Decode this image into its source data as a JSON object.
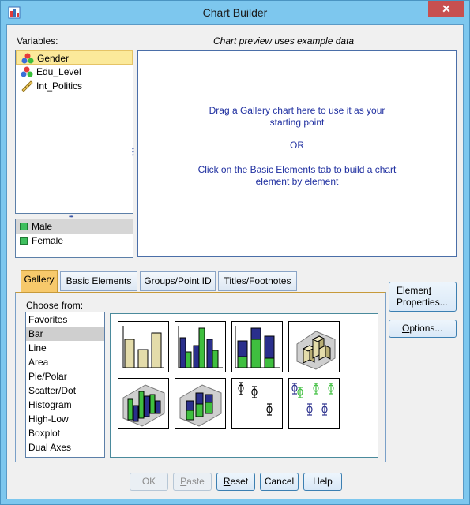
{
  "window": {
    "title": "Chart Builder",
    "close_glyph": "✕"
  },
  "variables": {
    "label": "Variables:",
    "items": [
      {
        "label": "Gender",
        "icon": "nominal-icon",
        "selected": true
      },
      {
        "label": "Edu_Level",
        "icon": "nominal-icon",
        "selected": false
      },
      {
        "label": "Int_Politics",
        "icon": "scale-icon",
        "selected": false
      }
    ]
  },
  "categories": {
    "items": [
      {
        "label": "Male",
        "selected": true
      },
      {
        "label": "Female",
        "selected": false
      }
    ]
  },
  "preview": {
    "caption": "Chart preview uses example data",
    "line1": "Drag a Gallery chart here to use it as your",
    "line2": "starting point",
    "line3": "OR",
    "line4": "Click on the Basic Elements tab to build a chart",
    "line5": "element by element"
  },
  "tabs": [
    {
      "label": "Gallery",
      "active": true
    },
    {
      "label": "Basic Elements",
      "active": false
    },
    {
      "label": "Groups/Point ID",
      "active": false
    },
    {
      "label": "Titles/Footnotes",
      "active": false
    }
  ],
  "choose": {
    "label": "Choose from:",
    "items": [
      "Favorites",
      "Bar",
      "Line",
      "Area",
      "Pie/Polar",
      "Scatter/Dot",
      "Histogram",
      "High-Low",
      "Boxplot",
      "Dual Axes"
    ],
    "selected": "Bar"
  },
  "gallery": {
    "thumbnails": [
      "simple-bar-icon",
      "clustered-bar-icon",
      "stacked-bar-icon",
      "3d-bar-icon",
      "3d-clustered-bar-icon",
      "3d-stacked-bar-icon",
      "error-bar-icon",
      "clustered-error-bar-icon"
    ]
  },
  "side_buttons": {
    "element_properties_line1_pre": "Elemen",
    "element_properties_line1_u": "t",
    "element_properties_line2": "Properties...",
    "options_u": "O",
    "options_rest": "ptions..."
  },
  "buttons": {
    "ok": "OK",
    "paste_u": "P",
    "paste_rest": "aste",
    "reset_u": "R",
    "reset_rest": "eset",
    "cancel": "Cancel",
    "help": "Help"
  },
  "colors": {
    "accent_tab": "#f7c96b",
    "preview_text": "#1f2fa0",
    "bar_tan": "#e4dcaa",
    "bar_navy": "#2a2f8c",
    "bar_green": "#3fbf3f"
  }
}
